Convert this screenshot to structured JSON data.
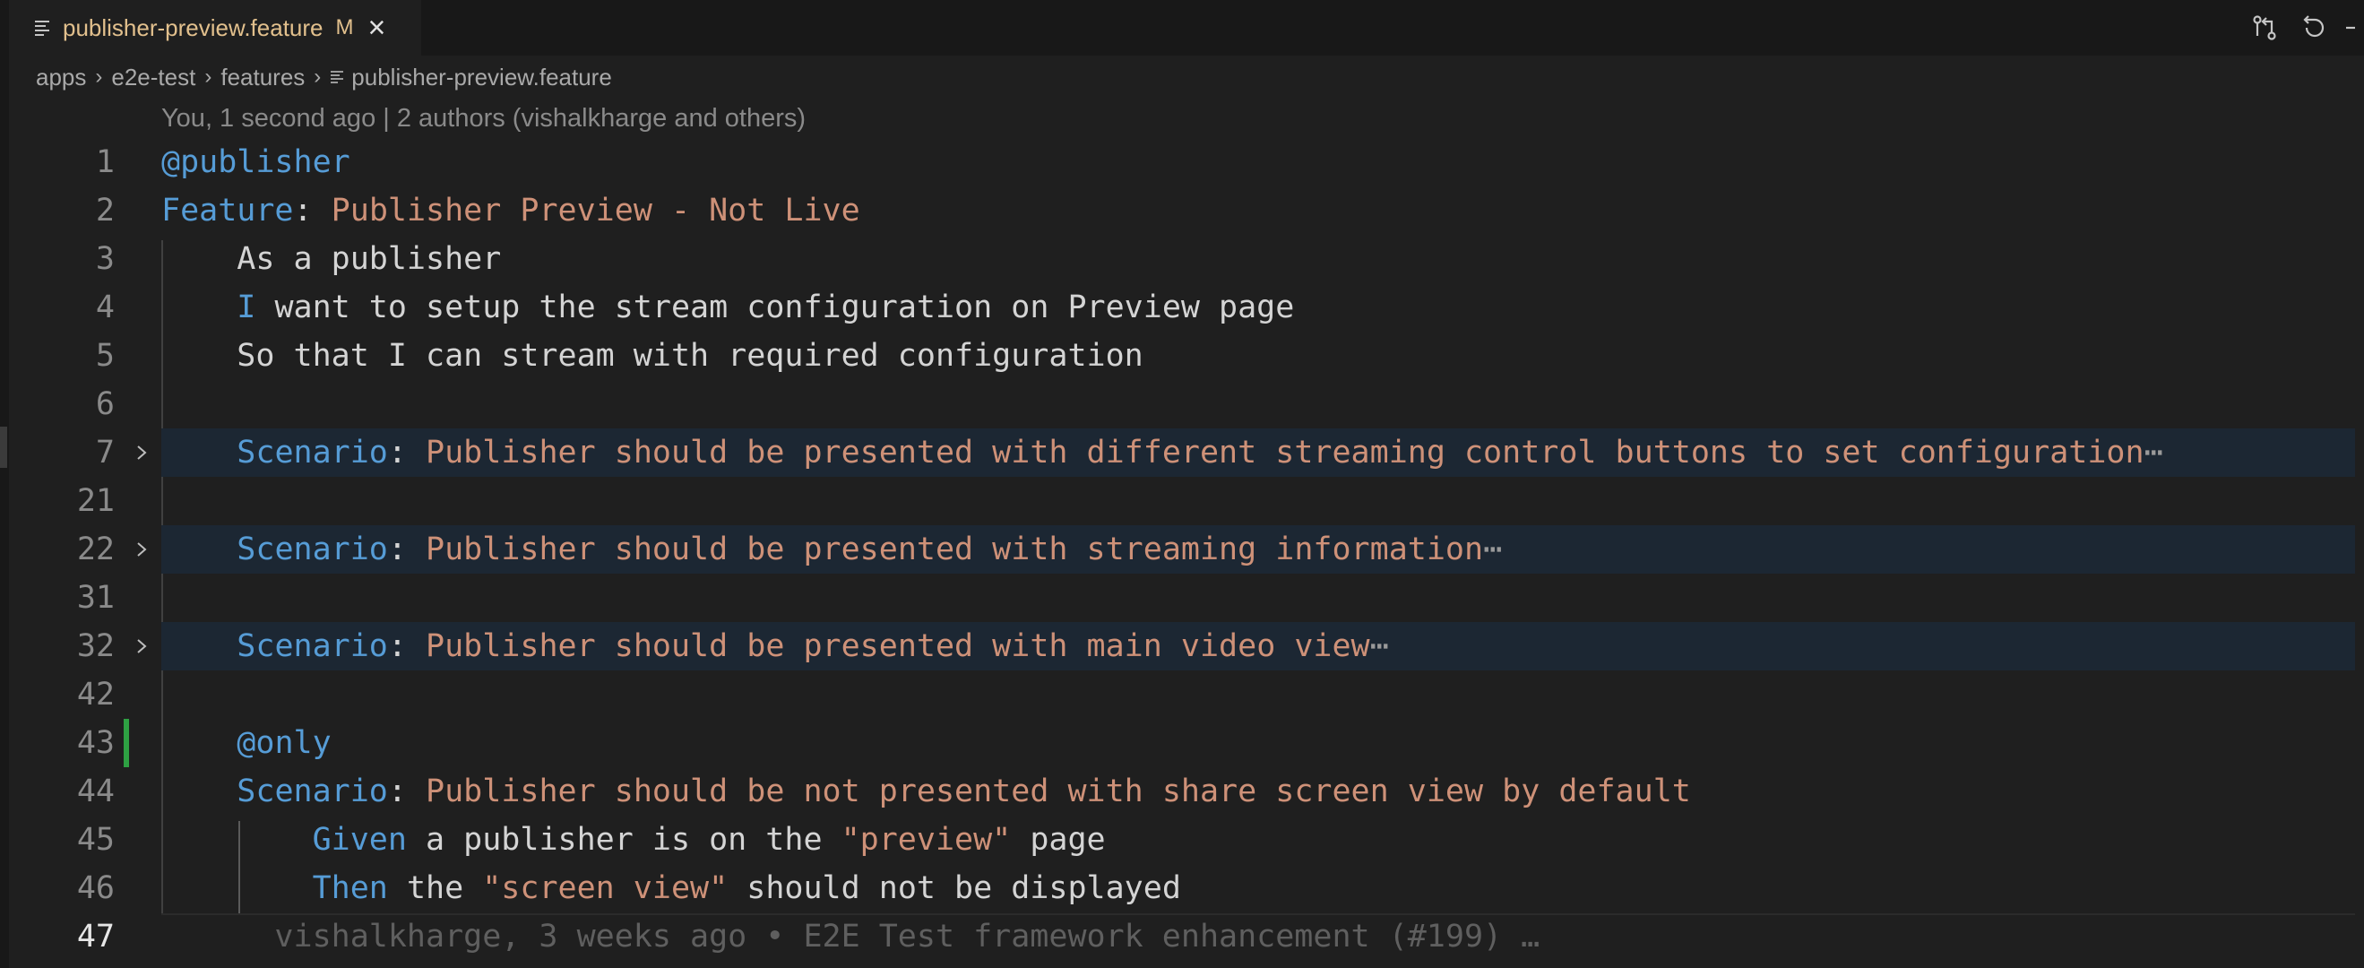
{
  "tab": {
    "filename": "publisher-preview.feature",
    "modified": "M"
  },
  "breadcrumb": [
    "apps",
    "e2e-test",
    "features",
    "publisher-preview.feature"
  ],
  "codelens": "You, 1 second ago | 2 authors (vishalkharge and others)",
  "lines": [
    {
      "num": "1",
      "segments": [
        {
          "t": "@publisher",
          "c": "kw"
        }
      ]
    },
    {
      "num": "2",
      "segments": [
        {
          "t": "Feature",
          "c": "kw"
        },
        {
          "t": ": ",
          "c": "txt"
        },
        {
          "t": "Publisher Preview - Not Live",
          "c": "str"
        }
      ]
    },
    {
      "num": "3",
      "segments": [
        {
          "t": "    As a publisher",
          "c": "txt"
        }
      ]
    },
    {
      "num": "4",
      "segments": [
        {
          "t": "    ",
          "c": "txt"
        },
        {
          "t": "I",
          "c": "kw"
        },
        {
          "t": " want to setup the stream configuration on Preview page",
          "c": "txt"
        }
      ]
    },
    {
      "num": "5",
      "segments": [
        {
          "t": "    So that I can stream with required configuration",
          "c": "txt"
        }
      ]
    },
    {
      "num": "6",
      "segments": []
    },
    {
      "num": "7",
      "folded": true,
      "segments": [
        {
          "t": "    ",
          "c": "txt"
        },
        {
          "t": "Scenario",
          "c": "kw"
        },
        {
          "t": ": ",
          "c": "txt"
        },
        {
          "t": "Publisher should be presented with different streaming control buttons to set configuration",
          "c": "str"
        },
        {
          "t": "⋯",
          "c": "ell"
        }
      ]
    },
    {
      "num": "21",
      "segments": []
    },
    {
      "num": "22",
      "folded": true,
      "segments": [
        {
          "t": "    ",
          "c": "txt"
        },
        {
          "t": "Scenario",
          "c": "kw"
        },
        {
          "t": ": ",
          "c": "txt"
        },
        {
          "t": "Publisher should be presented with streaming information",
          "c": "str"
        },
        {
          "t": "⋯",
          "c": "ell"
        }
      ]
    },
    {
      "num": "31",
      "segments": []
    },
    {
      "num": "32",
      "folded": true,
      "segments": [
        {
          "t": "    ",
          "c": "txt"
        },
        {
          "t": "Scenario",
          "c": "kw"
        },
        {
          "t": ": ",
          "c": "txt"
        },
        {
          "t": "Publisher should be presented with main video view",
          "c": "str"
        },
        {
          "t": "⋯",
          "c": "ell"
        }
      ]
    },
    {
      "num": "42",
      "segments": []
    },
    {
      "num": "43",
      "modified": true,
      "segments": [
        {
          "t": "    ",
          "c": "txt"
        },
        {
          "t": "@only",
          "c": "kw"
        }
      ]
    },
    {
      "num": "44",
      "segments": [
        {
          "t": "    ",
          "c": "txt"
        },
        {
          "t": "Scenario",
          "c": "kw"
        },
        {
          "t": ": ",
          "c": "txt"
        },
        {
          "t": "Publisher should be not presented with share screen view by default",
          "c": "str"
        }
      ]
    },
    {
      "num": "45",
      "segments": [
        {
          "t": "        ",
          "c": "txt"
        },
        {
          "t": "Given",
          "c": "kw"
        },
        {
          "t": " a publisher is on the ",
          "c": "txt"
        },
        {
          "t": "\"preview\"",
          "c": "str"
        },
        {
          "t": " page",
          "c": "txt"
        }
      ]
    },
    {
      "num": "46",
      "segments": [
        {
          "t": "        ",
          "c": "txt"
        },
        {
          "t": "Then",
          "c": "kw"
        },
        {
          "t": " the ",
          "c": "txt"
        },
        {
          "t": "\"screen view\"",
          "c": "str"
        },
        {
          "t": " should not be displayed",
          "c": "txt"
        }
      ]
    },
    {
      "num": "47",
      "active": true,
      "segments": [
        {
          "t": "      vishalkharge, 3 weeks ago • E2E Test framework enhancement (#199) …",
          "c": "blame"
        }
      ]
    }
  ],
  "colors": {
    "keyword": "#569cd6",
    "string": "#ce9178",
    "text": "#d4d4d4",
    "gutter_added": "#2ea043",
    "tab_label": "#e2c08d"
  },
  "icons": [
    "file-lines-icon",
    "close-icon",
    "git-compare-icon",
    "go-back-icon",
    "chevron-right-icon"
  ]
}
